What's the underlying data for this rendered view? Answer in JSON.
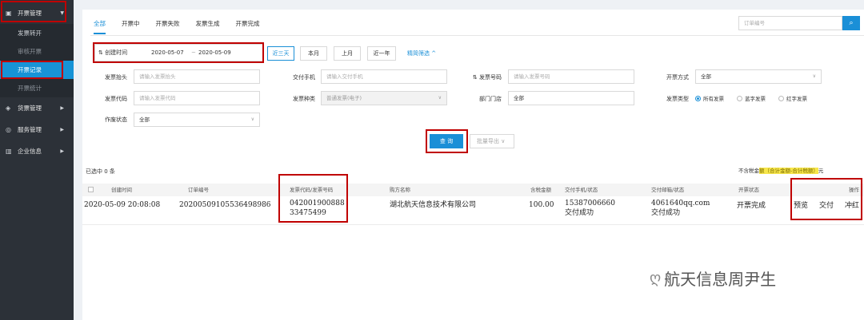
{
  "sidebar": {
    "top_label": "开票管理",
    "sub_items": [
      "发票转开",
      "审核开票",
      "开票记录",
      "开票统计"
    ],
    "groups": [
      "货票管理",
      "服务管理",
      "企业信息"
    ]
  },
  "tabs": [
    "全部",
    "开票中",
    "开票失败",
    "发票生成",
    "开票完成"
  ],
  "order_search": {
    "placeholder": "订单编号"
  },
  "date_filter": {
    "label": "⇅ 创建时间",
    "start": "2020-05-07",
    "sep": "~",
    "end": "2020-05-09"
  },
  "quick_buttons": [
    "近三天",
    "本月",
    "上月",
    "近一年"
  ],
  "advanced_filter": "精简筛选 ^",
  "filters": {
    "invoice_title": {
      "label": "发票抬头",
      "placeholder": "请输入发票抬头"
    },
    "delivery_phone": {
      "label": "交付手机",
      "placeholder": "请输入交付手机"
    },
    "invoice_number": {
      "label": "⇅ 发票号码",
      "placeholder": "请输入发票号码"
    },
    "issue_method": {
      "label": "开票方式",
      "value": "全部"
    },
    "invoice_code": {
      "label": "发票代码",
      "placeholder": "请输入发票代码"
    },
    "invoice_kind": {
      "label": "发票种类",
      "value": "普通发票(电子)"
    },
    "department": {
      "label": "部门门店",
      "value": "全部"
    },
    "invoice_type": {
      "label": "发票类型",
      "options": [
        "所有发票",
        "蓝字发票",
        "红字发票"
      ]
    },
    "void_status": {
      "label": "作废状态",
      "value": "全部"
    }
  },
  "buttons": {
    "query": "查 询",
    "export": "批量导出"
  },
  "table": {
    "selected": "已选中 0 条",
    "note_prefix": "不含税金",
    "note_mark": "额（合计金额-合计税额）",
    "note_suffix": "元",
    "headers": [
      "创建时间",
      "订单编号",
      "发票代码/发票号码",
      "购方名称",
      "含税金额",
      "交付手机/状态",
      "交付邮箱/状态",
      "开票状态",
      "操作"
    ],
    "row": {
      "created": "2020-05-09 20:08:08",
      "order": "20200509105536498986",
      "invoice_code": "042001900888",
      "invoice_no": "33475499",
      "buyer": "湖北航天信息技术有限公司",
      "amount": "100.00",
      "phone": "15387006660",
      "phone_status": "交付成功",
      "email": "4061640qq.com",
      "email_status": "交付成功",
      "status": "开票完成",
      "actions": [
        "预览",
        "交付",
        "冲红"
      ]
    }
  },
  "watermark": "航天信息周尹生"
}
